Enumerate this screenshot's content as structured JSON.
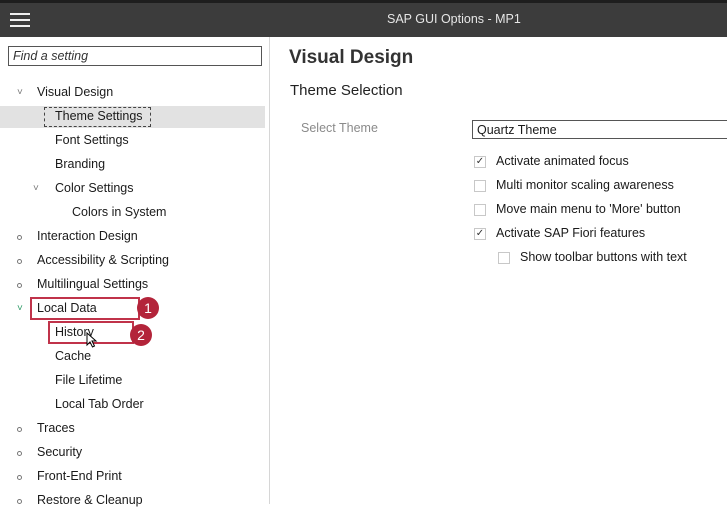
{
  "app": {
    "title": "SAP GUI Options - MP1"
  },
  "search": {
    "placeholder": "Find a setting"
  },
  "tree": [
    {
      "label": "Visual Design",
      "marker": "˅"
    },
    {
      "label": "Theme Settings",
      "marker": ""
    },
    {
      "label": "Font Settings",
      "marker": ""
    },
    {
      "label": "Branding",
      "marker": ""
    },
    {
      "label": "Color Settings",
      "marker": "˅"
    },
    {
      "label": "Colors in System",
      "marker": ""
    },
    {
      "label": "Interaction Design",
      "marker": "dot"
    },
    {
      "label": "Accessibility & Scripting",
      "marker": "dot"
    },
    {
      "label": "Multilingual Settings",
      "marker": "dot"
    },
    {
      "label": "Local Data",
      "marker": "˅"
    },
    {
      "label": "History",
      "marker": ""
    },
    {
      "label": "Cache",
      "marker": ""
    },
    {
      "label": "File Lifetime",
      "marker": ""
    },
    {
      "label": "Local Tab Order",
      "marker": ""
    },
    {
      "label": "Traces",
      "marker": "dot"
    },
    {
      "label": "Security",
      "marker": "dot"
    },
    {
      "label": "Front-End Print",
      "marker": "dot"
    },
    {
      "label": "Restore & Cleanup",
      "marker": "dot"
    }
  ],
  "annotations": {
    "badge1": "1",
    "badge2": "2"
  },
  "main": {
    "title": "Visual Design",
    "section": "Theme Selection",
    "theme_label": "Select Theme",
    "theme_value": "Quartz Theme",
    "options": [
      {
        "label": "Activate animated focus",
        "checked": true
      },
      {
        "label": "Multi monitor scaling awareness",
        "checked": false
      },
      {
        "label": "Move main menu to 'More' button",
        "checked": false
      },
      {
        "label": "Activate SAP Fiori features",
        "checked": true
      },
      {
        "label": "Show toolbar buttons with text",
        "checked": false
      }
    ]
  },
  "colors": {
    "titlebar": "#3c3c3c",
    "highlight": "#c0334a",
    "badge": "#b3243a",
    "selected": "#e2e2e2"
  }
}
